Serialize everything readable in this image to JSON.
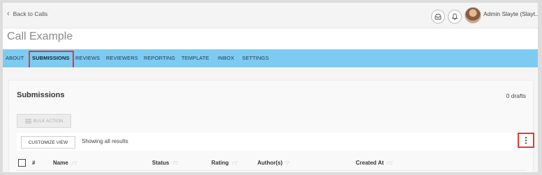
{
  "topbar": {
    "back_label": "Back to Calls",
    "user_name": "Admin Slayte (Slayt..."
  },
  "page": {
    "title": "Call Example"
  },
  "nav": {
    "items": [
      "ABOUT",
      "SUBMISSIONS",
      "REVIEWS",
      "REVIEWERS",
      "REPORTING",
      "TEMPLATE",
      "INBOX",
      "SETTINGS"
    ],
    "active": "SUBMISSIONS"
  },
  "submissions": {
    "title": "Submissions",
    "drafts": "0 drafts",
    "bulk_action": "BULK ACTION",
    "customize_view": "CUSTOMIZE VIEW",
    "showing": "Showing all results",
    "kebab": "⋮"
  },
  "table": {
    "columns": [
      "#",
      "Name",
      "Status",
      "Rating",
      "Author(s)",
      "Created At"
    ]
  },
  "colors": {
    "nav_bg": "#7ecbf2",
    "highlight": "#e53935"
  }
}
